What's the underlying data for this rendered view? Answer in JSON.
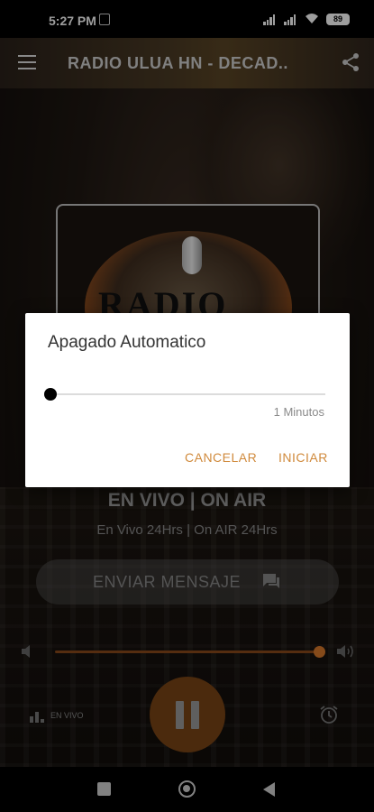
{
  "status_bar": {
    "time": "5:27 PM",
    "battery": "89"
  },
  "toolbar": {
    "title": "RADIO ULUA HN - DECAD.."
  },
  "logo": {
    "text": "RADIO"
  },
  "player": {
    "live_title": "EN VIVO | ON AIR",
    "live_subtitle": "En Vivo 24Hrs | On AIR 24Hrs",
    "send_message_label": "ENVIAR MENSAJE",
    "volume_percent": 100,
    "live_badge_label": "EN VIVO"
  },
  "dialog": {
    "title": "Apagado Automatico",
    "slider_value_label": "1 Minutos",
    "slider_value": 1,
    "cancel_label": "CANCELAR",
    "start_label": "INICIAR"
  },
  "colors": {
    "accent": "#d7782a",
    "dialog_button": "#d08a3c",
    "pause_button": "#7a4416"
  }
}
